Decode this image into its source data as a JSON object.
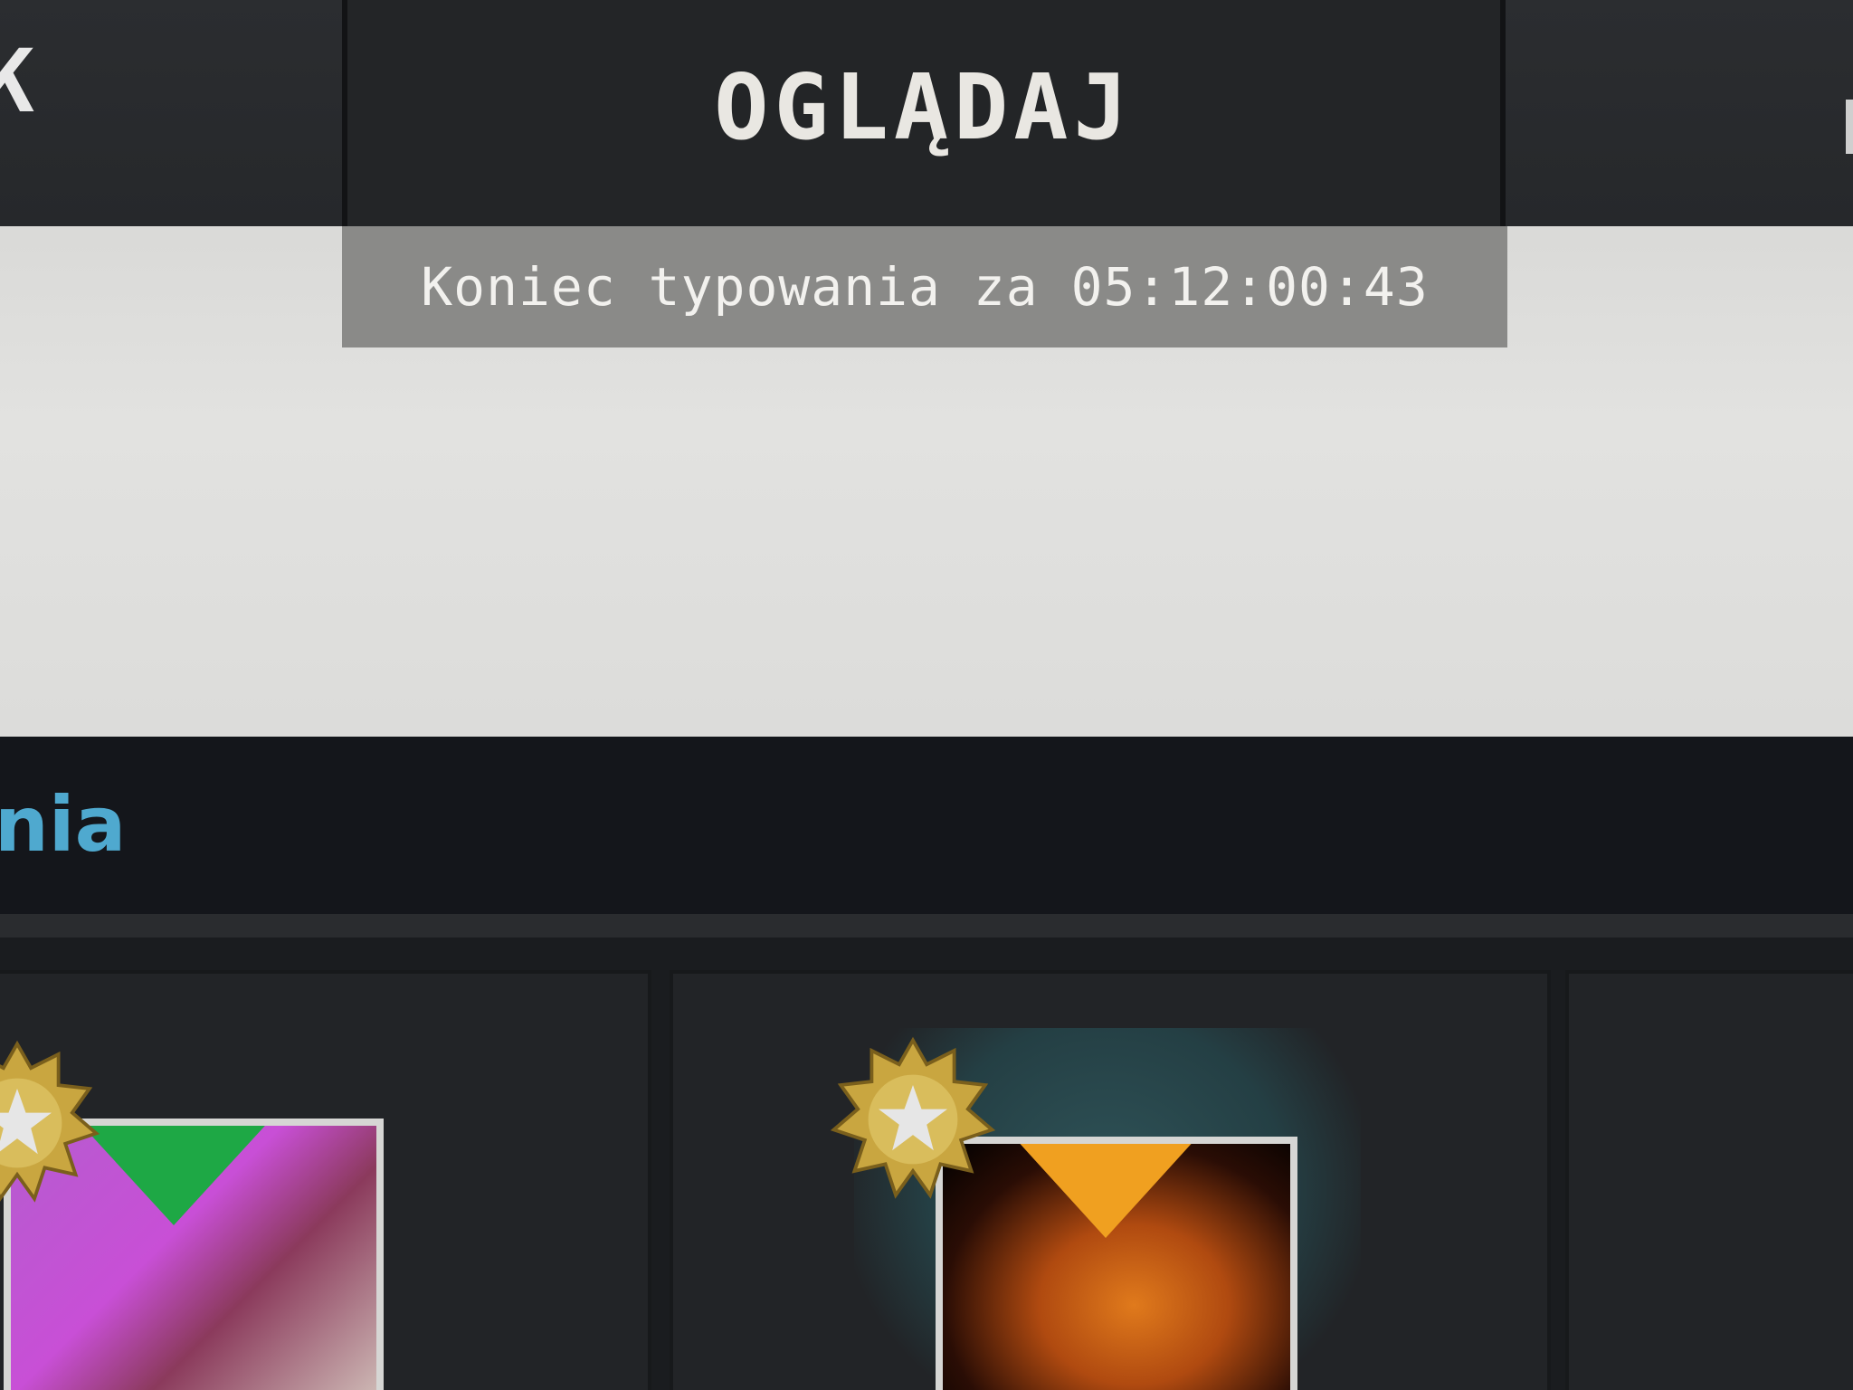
{
  "nav": {
    "left_glyph": "K",
    "active_tab": "OGLĄDAJ"
  },
  "countdown": {
    "text": "Koniec typowania za 05:12:00:43"
  },
  "section": {
    "title": "nia"
  },
  "colors": {
    "accent_blue": "#4fa9cf",
    "ribbon_green": "#1ea845",
    "ribbon_orange": "#f0a020"
  },
  "cards": [
    {
      "icon": "medal-icon"
    },
    {
      "icon": "medal-icon"
    }
  ]
}
